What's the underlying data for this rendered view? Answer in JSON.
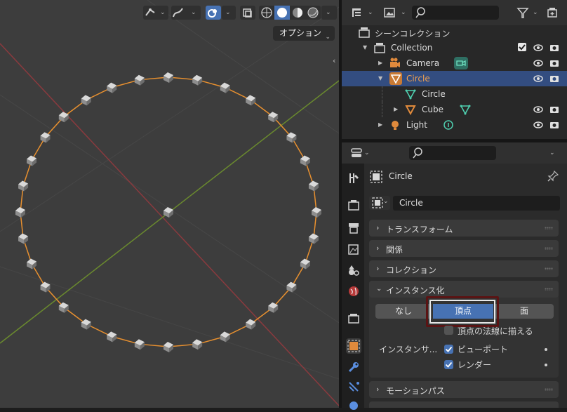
{
  "viewport": {
    "options_label": "オプション"
  },
  "outliner": {
    "scene_collection": "シーンコレクション",
    "items": [
      {
        "label": "Collection"
      },
      {
        "label": "Camera"
      },
      {
        "label": "Circle"
      },
      {
        "label": "Circle"
      },
      {
        "label": "Cube"
      },
      {
        "label": "Light"
      }
    ]
  },
  "properties": {
    "object_name": "Circle",
    "name_field": "Circle",
    "panels": {
      "transform": "トランスフォーム",
      "relations": "関係",
      "collections": "コレクション",
      "instancing": "インスタンス化",
      "motion_paths": "モーションパス"
    },
    "instancing": {
      "none": "なし",
      "vertices": "頂点",
      "faces": "面",
      "align_to_normal": "頂点の法線に揃える",
      "instancer_label": "インスタンサ...",
      "viewport": "ビューポート",
      "render": "レンダー"
    }
  },
  "colors": {
    "accent": "#4772b3",
    "selected_row": "#334d80",
    "object_orange": "#f0a050",
    "highlight_box": "#5a1414"
  }
}
